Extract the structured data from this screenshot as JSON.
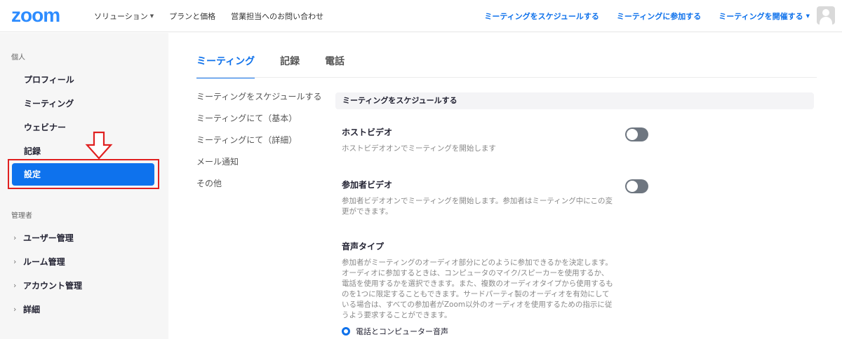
{
  "header": {
    "logo": "zoom",
    "nav_left": [
      {
        "label": "ソリューション",
        "has_dropdown": true
      },
      {
        "label": "プランと価格",
        "has_dropdown": false
      },
      {
        "label": "営業担当へのお問い合わせ",
        "has_dropdown": false
      }
    ],
    "nav_right": [
      {
        "label": "ミーティングをスケジュールする",
        "has_dropdown": false
      },
      {
        "label": "ミーティングに参加する",
        "has_dropdown": false
      },
      {
        "label": "ミーティングを開催する",
        "has_dropdown": true
      }
    ],
    "avatar_icon": "user-avatar-icon"
  },
  "sidebar": {
    "personal_label": "個人",
    "personal_items": [
      "プロフィール",
      "ミーティング",
      "ウェビナー",
      "記録"
    ],
    "active_item": "設定",
    "admin_label": "管理者",
    "admin_items": [
      "ユーザー管理",
      "ルーム管理",
      "アカウント管理",
      "詳細"
    ],
    "highlight_color": "#e02020"
  },
  "tabs": [
    "ミーティング",
    "記録",
    "電話"
  ],
  "active_tab_color": "#0e71eb",
  "subnav": [
    "ミーティングをスケジュールする",
    "ミーティングにて（基本）",
    "ミーティングにて（詳細）",
    "メール通知",
    "その他"
  ],
  "section_title": "ミーティングをスケジュールする",
  "settings": [
    {
      "title": "ホストビデオ",
      "desc": "ホストビデオオンでミーティングを開始します",
      "enabled": false
    },
    {
      "title": "参加者ビデオ",
      "desc": "参加者ビデオオンでミーティングを開始します。参加者はミーティング中にこの変更ができます。",
      "enabled": false
    },
    {
      "title": "音声タイプ",
      "desc": "参加者がミーティングのオーディオ部分にどのように参加できるかを決定します。オーディオに参加するときは、コンピュータのマイク/スピーカーを使用するか、電話を使用するかを選択できます。また、複数のオーディオタイプから使用するものを1つに限定することもできます。サードパーティ製のオーディオを有効にしている場合は、すべての参加者がZoom以外のオーディオを使用するための指示に従うよう要求することができます。"
    }
  ],
  "audio_option": {
    "label": "電話とコンピューター音声",
    "selected": true
  }
}
